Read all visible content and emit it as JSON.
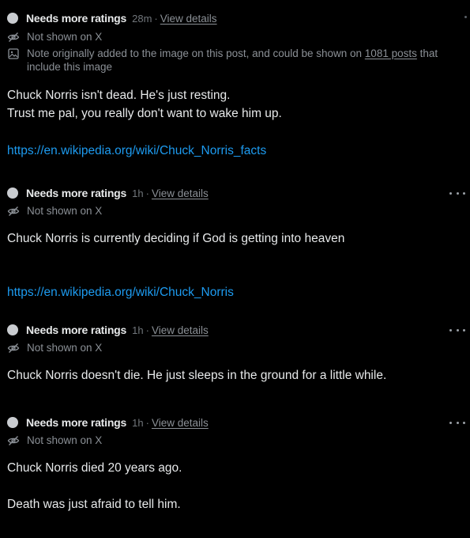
{
  "notes": [
    {
      "status": "Needs more ratings",
      "time": "28m",
      "separator": "·",
      "view_details": "View details",
      "visibility": "Not shown on X",
      "image_note_prefix": "Note originally added to the image on this post, and could be shown on",
      "image_note_link": "1081 posts",
      "image_note_suffix": "that include this image",
      "lines": [
        "Chuck Norris isn't dead. He's just resting.",
        "Trust me pal, you really don't want to wake him up."
      ],
      "link": "https://en.wikipedia.org/wiki/Chuck_Norris_facts"
    },
    {
      "status": "Needs more ratings",
      "time": "1h",
      "separator": "·",
      "view_details": "View details",
      "visibility": "Not shown on X",
      "lines": [
        "Chuck Norris is currently deciding if God is getting into heaven"
      ],
      "link": "https://en.wikipedia.org/wiki/Chuck_Norris"
    },
    {
      "status": "Needs more ratings",
      "time": "1h",
      "separator": "·",
      "view_details": "View details",
      "visibility": "Not shown on X",
      "lines": [
        "Chuck Norris doesn't die. He just sleeps in the ground for a little while."
      ]
    },
    {
      "status": "Needs more ratings",
      "time": "1h",
      "separator": "·",
      "view_details": "View details",
      "visibility": "Not shown on X",
      "lines": [
        "Chuck Norris died 20 years ago.",
        "Death was just afraid to tell him."
      ]
    }
  ],
  "icons": {
    "status": "status-dot-icon",
    "hidden": "eye-slash-icon",
    "image": "image-icon",
    "more": "more-icon"
  },
  "colors": {
    "background": "#000000",
    "text": "#e7e9ea",
    "muted": "#71767b",
    "link": "#1d9bf0",
    "status_dot": "#c9ccd0"
  }
}
